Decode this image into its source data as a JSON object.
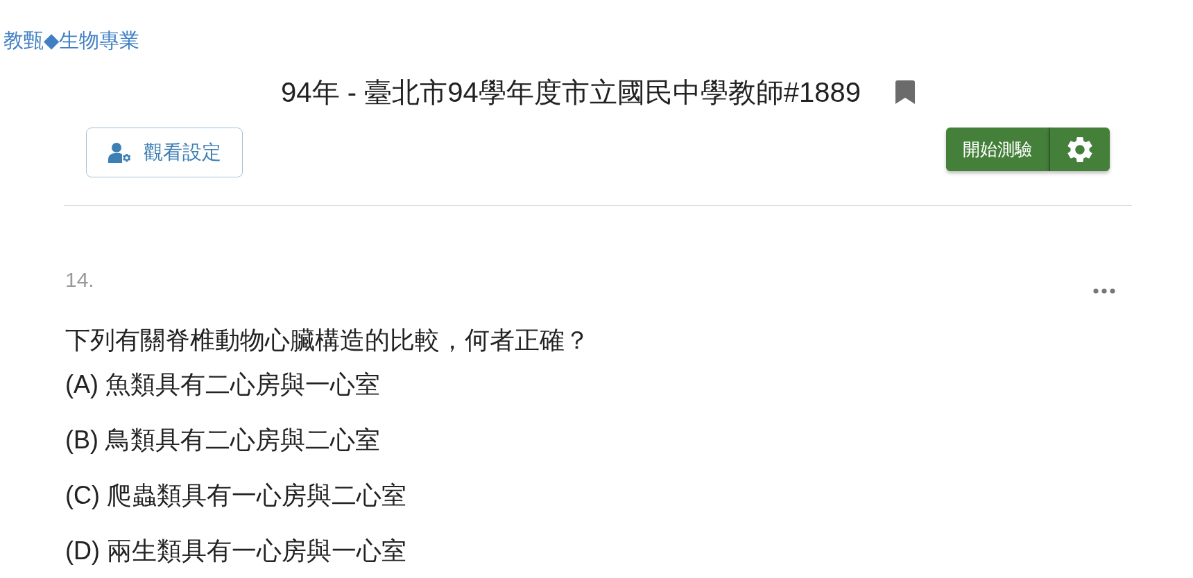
{
  "breadcrumb": "教甄◆生物專業",
  "title": "94年 - 臺北市94學年度市立國民中學教師#1889",
  "toolbar": {
    "view_settings": "觀看設定",
    "start_test": "開始測驗"
  },
  "question": {
    "number": "14.",
    "text": "下列有關脊椎動物心臟構造的比較，何者正確？",
    "options": [
      "(A) 魚類具有二心房與一心室",
      "(B) 鳥類具有二心房與二心室",
      "(C) 爬蟲類具有一心房與二心室",
      "(D) 兩生類具有一心房與一心室"
    ]
  }
}
